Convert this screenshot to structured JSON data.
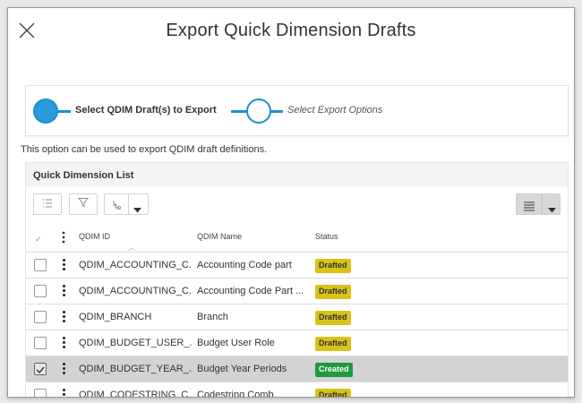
{
  "dialog": {
    "title": "Export Quick Dimension Drafts"
  },
  "wizard": {
    "step1_label": "Select QDIM Draft(s) to Export",
    "step2_label": "Select Export Options"
  },
  "description": "This option can be used to export QDIM draft definitions.",
  "list": {
    "title": "Quick Dimension List",
    "columns": {
      "check": "✓",
      "id": "QDIM ID",
      "name": "QDIM Name",
      "status": "Status"
    },
    "rows": [
      {
        "id": "QDIM_ACCOUNTING_C...",
        "name": "Accounting Code part",
        "status": "Drafted",
        "selected": false
      },
      {
        "id": "QDIM_ACCOUNTING_C...",
        "name": "Accounting Code Part ...",
        "status": "Drafted",
        "selected": false
      },
      {
        "id": "QDIM_BRANCH",
        "name": "Branch",
        "status": "Drafted",
        "selected": false
      },
      {
        "id": "QDIM_BUDGET_USER_...",
        "name": "Budget User Role",
        "status": "Drafted",
        "selected": false
      },
      {
        "id": "QDIM_BUDGET_YEAR_...",
        "name": "Budget Year Periods",
        "status": "Created",
        "selected": true
      },
      {
        "id": "QDIM_CODESTRING_C...",
        "name": "Codestring Comb",
        "status": "Drafted",
        "selected": false
      }
    ]
  },
  "colors": {
    "accent": "#1b8fd0",
    "drafted_bg": "#d9c21a",
    "drafted_text": "#333333",
    "created_bg": "#1f9a3c",
    "created_text": "#ffffff",
    "selected_row": "#d3d3d3"
  },
  "icons": {
    "close": "close-icon",
    "list": "list-icon",
    "filter": "filter-icon",
    "group": "group-icon",
    "view": "view-lines-icon",
    "dropdown": "caret-down-icon"
  }
}
